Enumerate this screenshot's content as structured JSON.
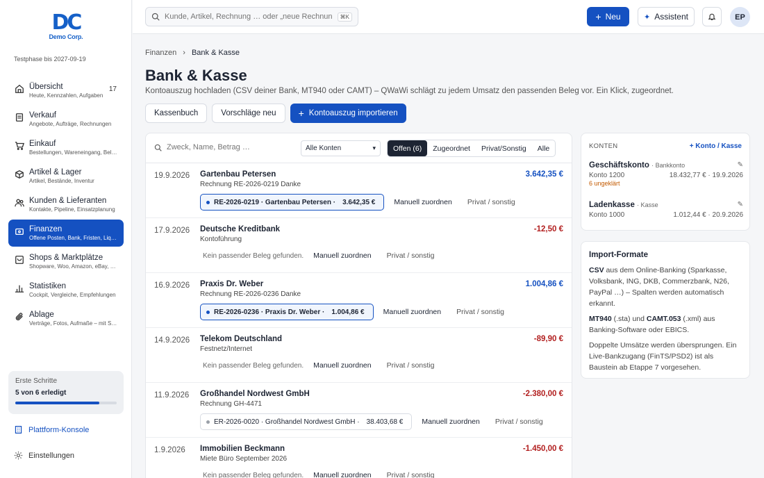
{
  "sidebar": {
    "logo_mark": "DC",
    "logo_text": "Demo Corp.",
    "trial": "Testphase bis 2027-09-19",
    "items": [
      {
        "label": "Übersicht",
        "sub": "Heute, Kennzahlen, Aufgaben",
        "count": "17",
        "icon": "home-icon"
      },
      {
        "label": "Verkauf",
        "sub": "Angebote, Aufträge, Rechnungen",
        "icon": "receipt-icon"
      },
      {
        "label": "Einkauf",
        "sub": "Bestellungen, Wareneingang, Belege",
        "icon": "cart-icon"
      },
      {
        "label": "Artikel & Lager",
        "sub": "Artikel, Bestände, Inventur",
        "icon": "box-icon"
      },
      {
        "label": "Kunden & Lieferanten",
        "sub": "Kontakte, Pipeline, Einsatzplanung",
        "icon": "users-icon"
      },
      {
        "label": "Finanzen",
        "sub": "Offene Posten, Bank, Fristen, Liquidität",
        "icon": "wallet-icon",
        "active": true
      },
      {
        "label": "Shops & Marktplätze",
        "sub": "Shopware, Woo, Amazon, eBay, Etsy",
        "icon": "shop-icon"
      },
      {
        "label": "Statistiken",
        "sub": "Cockpit, Vergleiche, Empfehlungen",
        "icon": "chart-icon"
      },
      {
        "label": "Ablage",
        "sub": "Verträge, Fotos, Aufmaße – mit Suche",
        "icon": "paperclip-icon"
      }
    ],
    "steps": {
      "title": "Erste Schritte",
      "progress_text": "5 von 6 erledigt",
      "progress": 0.83
    },
    "platform_link": "Plattform-Konsole",
    "settings_link": "Einstellungen"
  },
  "topbar": {
    "search_placeholder": "Kunde, Artikel, Rechnung … oder „neue Rechnung“",
    "shortcut": "⌘K",
    "new_label": "Neu",
    "assistant_label": "Assistent",
    "avatar": "EP"
  },
  "breadcrumb": {
    "parent": "Finanzen",
    "current": "Bank & Kasse"
  },
  "page": {
    "title": "Bank & Kasse",
    "subtitle": "Kontoauszug hochladen (CSV deiner Bank, MT940 oder CAMT) – QWaWi schlägt zu jedem Umsatz den passenden Beleg vor. Ein Klick, zugeordnet.",
    "btn_kassenbuch": "Kassenbuch",
    "btn_vorschlaege": "Vorschläge neu",
    "btn_import": "Kontoauszug importieren"
  },
  "filters": {
    "search_placeholder": "Zweck, Name, Betrag …",
    "account_select": "Alle Konten",
    "tabs": [
      "Offen (6)",
      "Zugeordnet",
      "Privat/Sonstig",
      "Alle"
    ]
  },
  "transactions": [
    {
      "date": "19.9.2026",
      "name": "Gartenbau Petersen",
      "desc": "Rechnung RE-2026-0219 Danke",
      "amount": "3.642,35 €",
      "sign": "pos",
      "match": "RE-2026-0219 · Gartenbau Petersen ·",
      "match_amount": "3.642,35 €",
      "match_type": "blue",
      "manual": "Manuell zuordnen",
      "private": "Privat / sonstig"
    },
    {
      "date": "17.9.2026",
      "name": "Deutsche Kreditbank",
      "desc": "Kontoführung",
      "amount": "-12,50 €",
      "sign": "neg",
      "nomatch": "Kein passender Beleg gefunden.",
      "manual": "Manuell zuordnen",
      "private": "Privat / sonstig"
    },
    {
      "date": "16.9.2026",
      "name": "Praxis Dr. Weber",
      "desc": "Rechnung RE-2026-0236 Danke",
      "amount": "1.004,86 €",
      "sign": "pos",
      "match": "RE-2026-0236 · Praxis Dr. Weber ·",
      "match_amount": "1.004,86 €",
      "match_type": "blue",
      "manual": "Manuell zuordnen",
      "private": "Privat / sonstig"
    },
    {
      "date": "14.9.2026",
      "name": "Telekom Deutschland",
      "desc": "Festnetz/Internet",
      "amount": "-89,90 €",
      "sign": "neg",
      "nomatch": "Kein passender Beleg gefunden.",
      "manual": "Manuell zuordnen",
      "private": "Privat / sonstig"
    },
    {
      "date": "11.9.2026",
      "name": "Großhandel Nordwest GmbH",
      "desc": "Rechnung GH-4471",
      "amount": "-2.380,00 €",
      "sign": "neg",
      "match": "ER-2026-0020 · Großhandel Nordwest GmbH ·",
      "match_amount": "38.403,68 €",
      "match_type": "grey",
      "manual": "Manuell zuordnen",
      "private": "Privat / sonstig"
    },
    {
      "date": "1.9.2026",
      "name": "Immobilien Beckmann",
      "desc": "Miete Büro September 2026",
      "amount": "-1.450,00 €",
      "sign": "neg",
      "nomatch": "Kein passender Beleg gefunden.",
      "manual": "Manuell zuordnen",
      "private": "Privat / sonstig"
    }
  ],
  "konten": {
    "header": "KONTEN",
    "add": "+ Konto / Kasse",
    "accounts": [
      {
        "name": "Geschäftskonto",
        "type": "· Bankkonto",
        "number": "Konto 1200",
        "balance": "18.432,77 € · 19.9.2026",
        "warning": "6 ungeklärt"
      },
      {
        "name": "Ladenkasse",
        "type": "· Kasse",
        "number": "Konto 1000",
        "balance": "1.012,44 € · 20.9.2026"
      }
    ]
  },
  "formats": {
    "title": "Import-Formate",
    "p1_bold": "CSV",
    "p1": " aus dem Online-Banking (Sparkasse, Volksbank, ING, DKB, Commerzbank, N26, PayPal …) – Spalten werden automatisch erkannt.",
    "p2_bold1": "MT940",
    "p2_mid": " (.sta) und ",
    "p2_bold2": "CAMT.053",
    "p2_end": " (.xml) aus Banking-Software oder EBICS.",
    "p3": "Doppelte Umsätze werden übersprungen. Ein Live-Bankzugang (FinTS/PSD2) ist als Baustein ab Etappe 7 vorgesehen."
  }
}
